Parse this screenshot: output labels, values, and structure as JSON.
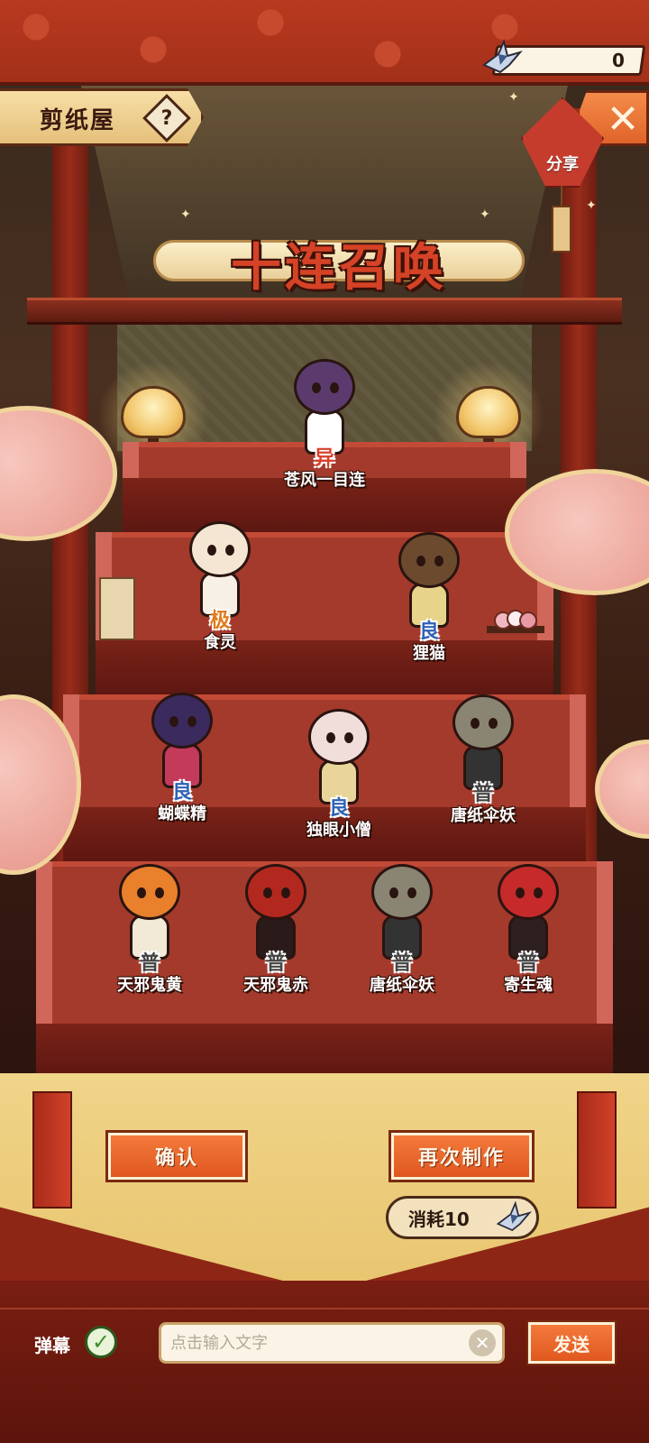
{
  "header": {
    "title": "剪纸屋",
    "help_symbol": "?",
    "close_symbol": "✕",
    "share_label": "分享",
    "currency": {
      "value": "0",
      "icon": "paper-crane-icon"
    }
  },
  "banner": {
    "title": "十连召唤"
  },
  "characters": [
    {
      "name": "苍风一目连",
      "rarity": "SSR",
      "rarity_text": "异",
      "rarity_color": "#d9402a",
      "head_color": "#5b3b6e",
      "body_color": "#ffffff"
    },
    {
      "name": "食灵",
      "rarity": "SR",
      "rarity_text": "极",
      "rarity_color": "#e07a1a",
      "head_color": "#f4e6d2",
      "body_color": "#f7f0e6"
    },
    {
      "name": "狸猫",
      "rarity": "R",
      "rarity_text": "良",
      "rarity_color": "#2f63b6",
      "head_color": "#6b4a2e",
      "body_color": "#e8d38a"
    },
    {
      "name": "蝴蝶精",
      "rarity": "R",
      "rarity_text": "良",
      "rarity_color": "#2f63b6",
      "head_color": "#3b2a5e",
      "body_color": "#c43a5a"
    },
    {
      "name": "独眼小僧",
      "rarity": "R",
      "rarity_text": "良",
      "rarity_color": "#2f63b6",
      "head_color": "#f1dedb",
      "body_color": "#e9d59a"
    },
    {
      "name": "唐纸伞妖",
      "rarity": "N",
      "rarity_text": "普",
      "rarity_color": "#444444",
      "head_color": "#8a8572",
      "body_color": "#333333"
    },
    {
      "name": "天邪鬼黄",
      "rarity": "N",
      "rarity_text": "普",
      "rarity_color": "#444444",
      "head_color": "#e8802c",
      "body_color": "#f2e9d6"
    },
    {
      "name": "天邪鬼赤",
      "rarity": "N",
      "rarity_text": "普",
      "rarity_color": "#444444",
      "head_color": "#b3281e",
      "body_color": "#2a1a1a"
    },
    {
      "name": "唐纸伞妖",
      "rarity": "N",
      "rarity_text": "普",
      "rarity_color": "#444444",
      "head_color": "#8a8572",
      "body_color": "#333333"
    },
    {
      "name": "寄生魂",
      "rarity": "N",
      "rarity_text": "普",
      "rarity_color": "#444444",
      "head_color": "#c62a2a",
      "body_color": "#2e2020"
    }
  ],
  "actions": {
    "confirm_label": "确认",
    "remake_label": "再次制作",
    "cost_label": "消耗10",
    "cost_icon": "paper-crane-icon"
  },
  "chat": {
    "danmu_label": "弹幕",
    "danmu_enabled": true,
    "check_symbol": "✓",
    "input_placeholder": "点击输入文字",
    "input_value": "",
    "clear_symbol": "✕",
    "send_label": "发送"
  },
  "colors": {
    "accent_orange": "#e0581f",
    "carpet_red": "#a43a2c",
    "gold": "#e8c56f"
  }
}
